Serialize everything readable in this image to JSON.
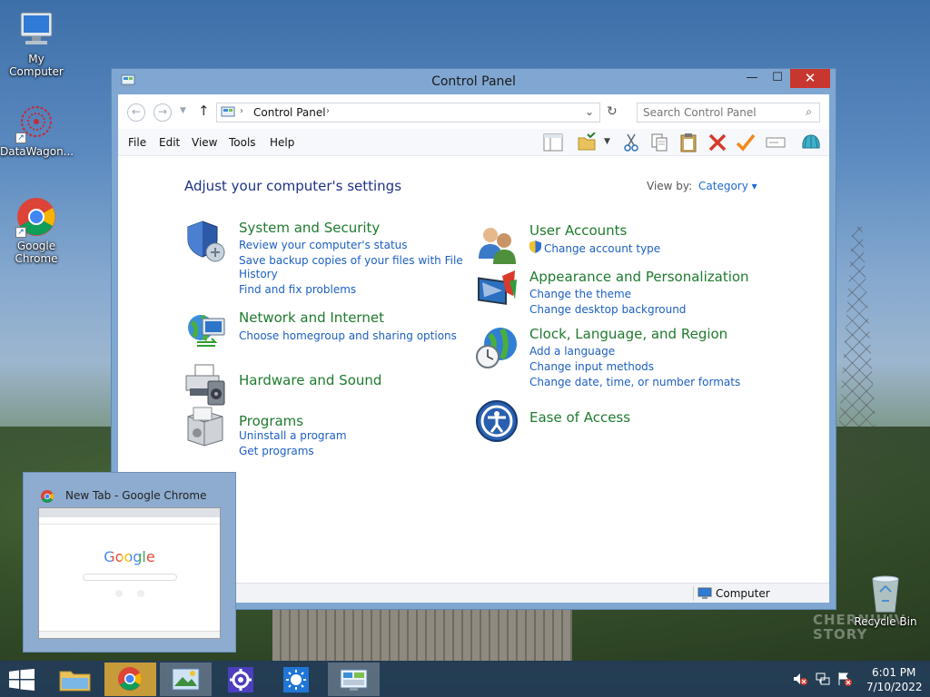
{
  "desktop": {
    "icons": [
      {
        "label": "My Computer"
      },
      {
        "label": "DataWagon..."
      },
      {
        "label": "Google Chrome"
      },
      {
        "label": "Recycle Bin"
      }
    ],
    "watermark": "CHERNIHIV STORY"
  },
  "window": {
    "title": "Control Panel",
    "controls": {
      "minimize": "—",
      "maximize": "☐",
      "close": "✕"
    },
    "address": {
      "crumb": "Control Panel"
    },
    "search": {
      "placeholder": "Search Control Panel"
    },
    "menu": [
      "File",
      "Edit",
      "View",
      "Tools",
      "Help"
    ],
    "heading": "Adjust your computer's settings",
    "view_by": {
      "label": "View by:",
      "value": "Category ▾"
    },
    "categories_left": [
      {
        "title": "System and Security",
        "links": [
          "Review your computer's status",
          "Save backup copies of your files with File",
          "History",
          "Find and fix problems"
        ]
      },
      {
        "title": "Network and Internet",
        "links": [
          "Choose homegroup and sharing options"
        ]
      },
      {
        "title": "Hardware and Sound",
        "links": []
      },
      {
        "title": "Programs",
        "links": [
          "Uninstall a program",
          "Get programs"
        ]
      }
    ],
    "categories_right": [
      {
        "title": "User Accounts",
        "links": [
          "Change account type"
        ]
      },
      {
        "title": "Appearance and Personalization",
        "links": [
          "Change the theme",
          "Change desktop background"
        ]
      },
      {
        "title": "Clock, Language, and Region",
        "links": [
          "Add a language",
          "Change input methods",
          "Change date, time, or number formats"
        ]
      },
      {
        "title": "Ease of Access",
        "links": []
      }
    ],
    "status": "Computer"
  },
  "preview": {
    "title": "New Tab - Google Chrome",
    "thumb_logo": "Google"
  },
  "taskbar": {
    "clock": {
      "time": "6:01 PM",
      "date": "7/10/2022"
    }
  },
  "colors": {
    "accent_link": "#1c5fc2",
    "category_title": "#1e7a2e",
    "heading": "#1e3287",
    "close": "#c7372f"
  }
}
